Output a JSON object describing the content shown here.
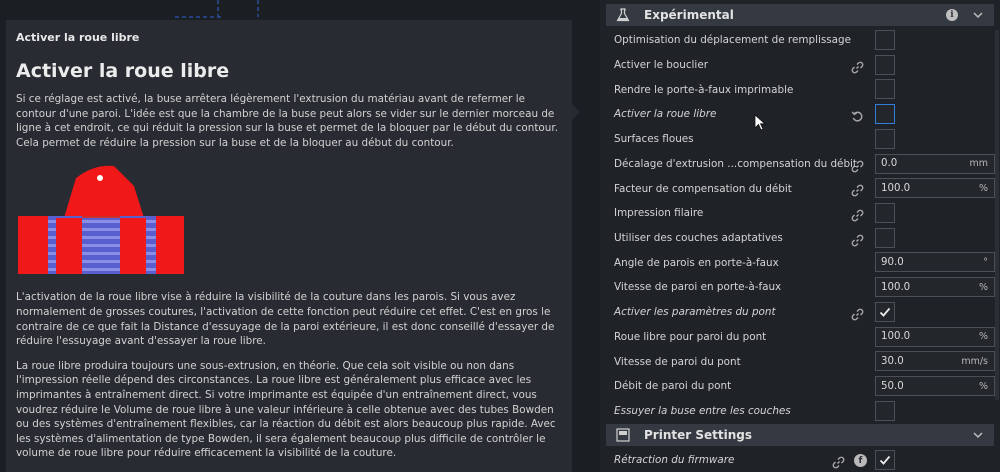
{
  "tooltip": {
    "header": "Activer la roue libre",
    "title": "Activer la roue libre",
    "paragraphs": [
      "Si ce réglage est activé, la buse arrêtera légèrement l'extrusion du matériau avant de refermer le contour d'une paroi. L'idée est que la chambre de la buse peut alors se vider sur le dernier morceau de ligne à cet endroit, ce qui réduit la pression sur la buse et permet de la bloquer par le début du contour. Cela permet de réduire la pression sur la buse et de la bloquer au début du contour.",
      "L'activation de la roue libre vise à réduire la visibilité de la couture dans les parois. Si vous avez normalement de grosses coutures, l'activation de cette fonction peut réduire cet effet. C'est en gros le contraire de ce que fait la Distance d'essuyage de la paroi extérieure, il est donc conseillé d'essayer de réduire l'essuyage avant d'essayer la roue libre.",
      "La roue libre produira toujours une sous-extrusion, en théorie. Que cela soit visible ou non dans l'impression réelle dépend des circonstances. La roue libre est généralement plus efficace avec les imprimantes à entraînement direct. Si votre imprimante est équipée d'un entraînement direct, vous voudrez réduire le Volume de roue libre à une valeur inférieure à celle obtenue avec des tubes Bowden ou des systèmes d'entraînement flexibles, car la réaction du débit est alors beaucoup plus rapide. Avec les systèmes d'alimentation de type Bowden, il sera également beaucoup plus difficile de contrôler le volume de roue libre pour réduire efficacement la visibilité de la couture."
    ]
  },
  "settings": {
    "section_experimental": {
      "title": "Expérimental",
      "icon": "flask-icon"
    },
    "rows": [
      {
        "label": "Optimisation du déplacement de remplissage",
        "type": "checkbox",
        "checked": false
      },
      {
        "label": "Activer le bouclier",
        "type": "checkbox",
        "checked": false,
        "linked": true
      },
      {
        "label": "Rendre le porte-à-faux imprimable",
        "type": "checkbox",
        "checked": false
      },
      {
        "label": "Activer la roue libre",
        "type": "checkbox",
        "checked": false,
        "italic": true,
        "reset": true,
        "focused": true
      },
      {
        "label": "Surfaces floues",
        "type": "checkbox",
        "checked": false
      },
      {
        "label": "Décalage d'extrusion ...compensation du débit",
        "type": "field",
        "value": "0.0",
        "unit": "mm",
        "linked": true
      },
      {
        "label": "Facteur de compensation du débit",
        "type": "field",
        "value": "100.0",
        "unit": "%",
        "linked": true
      },
      {
        "label": "Impression filaire",
        "type": "checkbox",
        "checked": false,
        "linked": true
      },
      {
        "label": "Utiliser des couches adaptatives",
        "type": "checkbox",
        "checked": false,
        "linked": true
      },
      {
        "label": "Angle de parois en porte-à-faux",
        "type": "field",
        "value": "90.0",
        "unit": "°"
      },
      {
        "label": "Vitesse de paroi en porte-à-faux",
        "type": "field",
        "value": "100.0",
        "unit": "%"
      },
      {
        "label": "Activer les paramètres du pont",
        "type": "checkbox",
        "checked": true,
        "italic": true,
        "linked": true
      },
      {
        "label": "Roue libre pour paroi du pont",
        "type": "field",
        "value": "100.0",
        "unit": "%"
      },
      {
        "label": "Vitesse de paroi du pont",
        "type": "field",
        "value": "30.0",
        "unit": "mm/s"
      },
      {
        "label": "Débit de paroi du pont",
        "type": "field",
        "value": "50.0",
        "unit": "%"
      },
      {
        "label": "Essuyer la buse entre les couches",
        "type": "checkbox",
        "checked": false,
        "italic": true
      }
    ],
    "section_printer": {
      "title": "Printer Settings",
      "icon": "printer-icon"
    },
    "printer_rows": [
      {
        "label": "Rétraction du firmware",
        "type": "checkbox",
        "checked": true,
        "italic": true,
        "linked": true,
        "firmware": true
      }
    ]
  },
  "colors": {
    "accent": "#2f7fd6",
    "panel_bg": "#282b31",
    "header_bg": "#353a42"
  }
}
